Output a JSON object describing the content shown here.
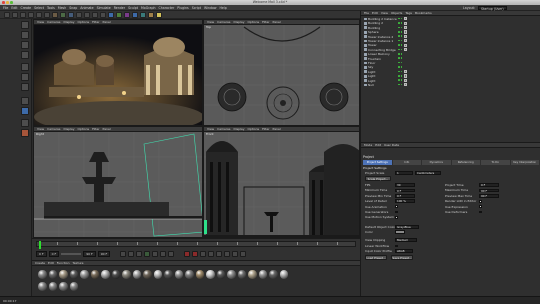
{
  "window": {
    "title": "Welcome Mall 3.c4d *",
    "layout_label": "Layout:",
    "layout_value": "Startup (User)"
  },
  "menu": [
    "File",
    "Edit",
    "Create",
    "Select",
    "Tools",
    "Mesh",
    "Snap",
    "Animate",
    "Simulate",
    "Render",
    "Sculpt",
    "MoGraph",
    "Character",
    "Plugins",
    "Script",
    "Window",
    "Help"
  ],
  "viewport_menu": [
    "View",
    "Cameras",
    "Display",
    "Options",
    "Filter",
    "Panel"
  ],
  "viewports": {
    "perspective": "Perspective",
    "top": "Top",
    "right": "Right",
    "front": "Front"
  },
  "timeline": {
    "frame_field": "0 F",
    "start_field": "0 F",
    "end_field": "90 F",
    "end_field2": "90 F"
  },
  "materials_menu": [
    "Create",
    "Edit",
    "Function",
    "Texture"
  ],
  "object_manager": {
    "menu": [
      "File",
      "Edit",
      "View",
      "Objects",
      "Tags",
      "Bookmarks"
    ],
    "objects": [
      "Building 2 Instance",
      "Building 2",
      "Building",
      "Sphere",
      "Tower Instance 2",
      "Tower Instance 1",
      "Tower",
      "Connecting Bridge",
      "Lower Balcony",
      "Fountain",
      "Floor",
      "Sky",
      "Light",
      "Light",
      "Light",
      "Null"
    ]
  },
  "attributes": {
    "menu": [
      "Mode",
      "Edit",
      "User Data"
    ],
    "title": "Project",
    "tabs": [
      "Project Settings",
      "Info",
      "Dynamics",
      "Referencing",
      "To Do",
      "Key Interpolation"
    ],
    "section": "Project Settings",
    "project_scale_label": "Project Scale",
    "project_scale_value": "1",
    "project_scale_unit": "Centimeters",
    "scale_project_button": "Scale Project...",
    "left_rows": [
      {
        "label": "FPS",
        "value": "30"
      },
      {
        "label": "Minimum Time",
        "value": "0 F"
      },
      {
        "label": "Preview Min Time",
        "value": "0 F"
      },
      {
        "label": "Level of Detail",
        "value": "100 %"
      },
      {
        "label": "Use Animation",
        "value": ""
      },
      {
        "label": "Use Generators",
        "value": ""
      },
      {
        "label": "Use Motion System",
        "value": ""
      }
    ],
    "right_rows": [
      {
        "label": "Project Time",
        "value": "0 F"
      },
      {
        "label": "Maximum Time",
        "value": "90 F"
      },
      {
        "label": "Preview Max Time",
        "value": "90 F"
      },
      {
        "label": "Render LOD in Editor",
        "value": ""
      },
      {
        "label": "Use Expression",
        "value": ""
      },
      {
        "label": "Use Deformers",
        "value": ""
      }
    ],
    "default_color_label": "Default Object Color",
    "default_color_value": "Gray-Blue",
    "color_label": "Color",
    "view_clipping_label": "View Clipping",
    "view_clipping_value": "Medium",
    "linear_workflow_label": "Linear Workflow",
    "input_color_label": "Input Color Profile",
    "input_color_value": "sRGB",
    "load_preset_button": "Load Preset...",
    "save_preset_button": "Save Preset..."
  },
  "status": "00:00:17"
}
